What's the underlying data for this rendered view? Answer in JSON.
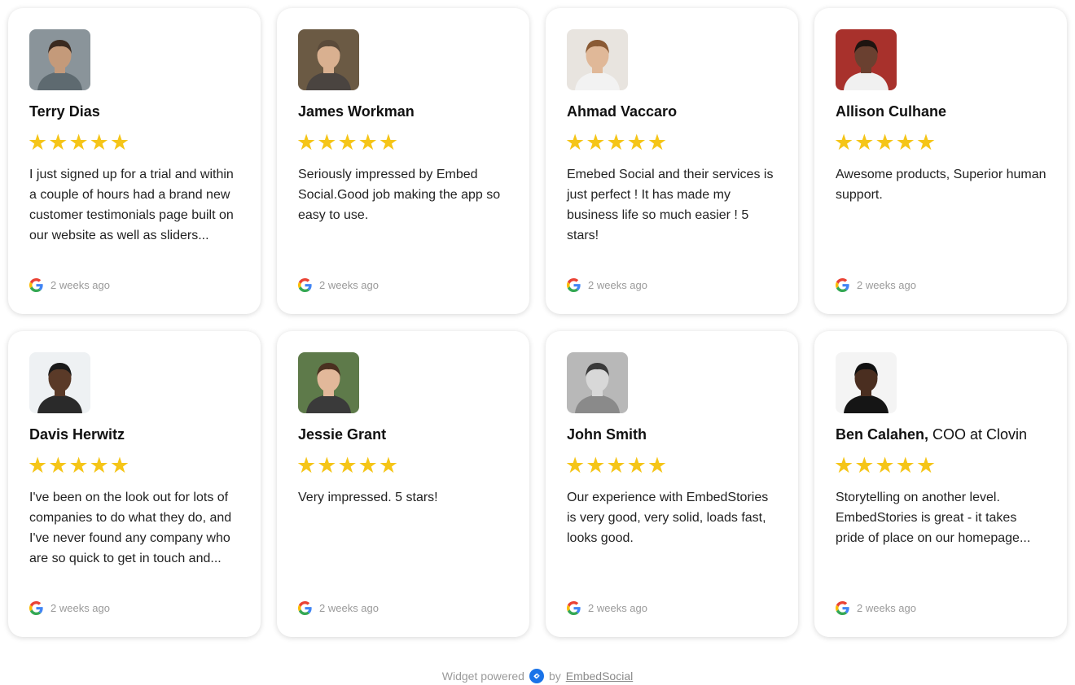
{
  "reviews": [
    {
      "name": "Terry Dias",
      "role": "",
      "rating": 5,
      "text": "I just signed up for a trial and within a couple of hours had a brand new customer testimonials page built on our website as well as sliders...",
      "source_icon": "google-icon",
      "time": "2 weeks ago",
      "colors": {
        "bg": "#8a949a",
        "skin": "#c49a7a",
        "hair": "#3a2a20",
        "shirt": "#5e6a70"
      }
    },
    {
      "name": "James Workman",
      "role": "",
      "rating": 5,
      "text": "Seriously impressed by Embed Social.Good job making the app so easy to use.",
      "source_icon": "google-icon",
      "time": "2 weeks ago",
      "colors": {
        "bg": "#6b5a44",
        "skin": "#d9b090",
        "hair": "#5a4a3a",
        "shirt": "#4a4440"
      }
    },
    {
      "name": "Ahmad Vaccaro",
      "role": "",
      "rating": 5,
      "text": "Emebed Social and their services is just perfect ! It has made my business life so much easier ! 5 stars!",
      "source_icon": "google-icon",
      "time": "2 weeks ago",
      "colors": {
        "bg": "#e8e4df",
        "skin": "#e0b898",
        "hair": "#8a5a34",
        "shirt": "#f2f2f2"
      }
    },
    {
      "name": "Allison Culhane",
      "role": "",
      "rating": 5,
      "text": "Awesome products, Superior human support.",
      "source_icon": "google-icon",
      "time": "2 weeks ago",
      "colors": {
        "bg": "#a8312c",
        "skin": "#6a4030",
        "hair": "#1e1410",
        "shirt": "#f0f0f0"
      }
    },
    {
      "name": "Davis Herwitz",
      "role": "",
      "rating": 5,
      "text": "I've been on the look out for lots of companies to do what they do, and I've never found any company who are so quick to get in touch and...",
      "source_icon": "google-icon",
      "time": "2 weeks ago",
      "colors": {
        "bg": "#eef1f3",
        "skin": "#5a3a28",
        "hair": "#1a1a1a",
        "shirt": "#2a2a2a"
      }
    },
    {
      "name": "Jessie Grant",
      "role": "",
      "rating": 5,
      "text": "Very impressed. 5 stars!",
      "source_icon": "google-icon",
      "time": "2 weeks ago",
      "colors": {
        "bg": "#5e7a4a",
        "skin": "#e2b89a",
        "hair": "#4a3020",
        "shirt": "#3a3a3a"
      }
    },
    {
      "name": "John Smith",
      "role": "",
      "rating": 5,
      "text": "Our experience with EmbedStories is very good, very solid, loads fast, looks good.",
      "source_icon": "google-icon",
      "time": "2 weeks ago",
      "colors": {
        "bg": "#b8b8b8",
        "skin": "#d8d8d8",
        "hair": "#3a3a3a",
        "shirt": "#8a8a8a"
      }
    },
    {
      "name": "Ben Calahen,",
      "role": " COO at Clovin",
      "rating": 5,
      "text": "Storytelling on another level. EmbedStories is great - it takes pride of place on our homepage...",
      "source_icon": "google-icon",
      "time": "2 weeks ago",
      "colors": {
        "bg": "#f4f4f4",
        "skin": "#4a2e20",
        "hair": "#111111",
        "shirt": "#151515"
      }
    }
  ],
  "footer": {
    "prefix": "Widget powered",
    "by": "by",
    "brand": "EmbedSocial",
    "brand_icon": "embedsocial-logo-icon",
    "brand_color": "#1a73e8"
  },
  "colors": {
    "star": "#f5c518",
    "meta_text": "#9a9a9a"
  }
}
